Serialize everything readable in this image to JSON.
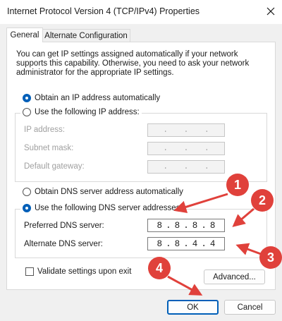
{
  "window": {
    "title": "Internet Protocol Version 4 (TCP/IPv4) Properties",
    "close_icon": "close-icon"
  },
  "tabs": [
    {
      "label": "General",
      "active": true
    },
    {
      "label": "Alternate Configuration",
      "active": false
    }
  ],
  "intro_text": "You can get IP settings assigned automatically if your network supports this capability. Otherwise, you need to ask your network administrator for the appropriate IP settings.",
  "ip": {
    "auto_label": "Obtain an IP address automatically",
    "manual_label": "Use the following IP address:",
    "selected": "auto",
    "fields": [
      {
        "label": "IP address:",
        "value": ". . ."
      },
      {
        "label": "Subnet mask:",
        "value": ". . ."
      },
      {
        "label": "Default gateway:",
        "value": ". . ."
      }
    ]
  },
  "dns": {
    "auto_label": "Obtain DNS server address automatically",
    "manual_label": "Use the following DNS server addresses:",
    "selected": "manual",
    "preferred_label": "Preferred DNS server:",
    "preferred_octets": [
      "8",
      "8",
      "8",
      "8"
    ],
    "alternate_label": "Alternate DNS server:",
    "alternate_octets": [
      "8",
      "8",
      "4",
      "4"
    ]
  },
  "validate_label": "Validate settings upon exit",
  "buttons": {
    "advanced": "Advanced...",
    "ok": "OK",
    "cancel": "Cancel"
  },
  "annotations": {
    "markers": [
      "1",
      "2",
      "3",
      "4"
    ],
    "color": "#e0413b"
  },
  "colors": {
    "accent": "#005fb8"
  }
}
